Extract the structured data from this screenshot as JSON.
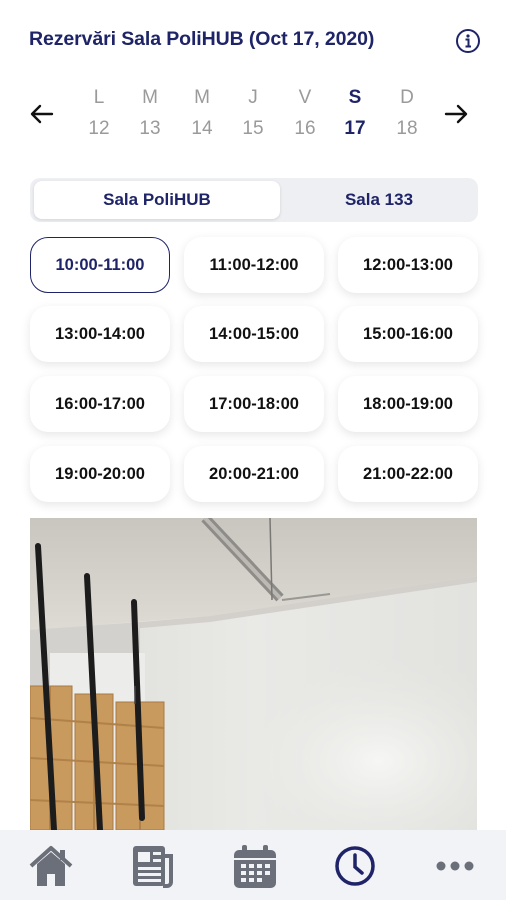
{
  "header": {
    "title": "Rezervări Sala PoliHUB (Oct 17, 2020)",
    "info_icon": "info-icon"
  },
  "week": {
    "prev_icon": "arrow-left-icon",
    "next_icon": "arrow-right-icon",
    "days": [
      {
        "letter": "L",
        "number": "12"
      },
      {
        "letter": "M",
        "number": "13"
      },
      {
        "letter": "M",
        "number": "14"
      },
      {
        "letter": "J",
        "number": "15"
      },
      {
        "letter": "V",
        "number": "16"
      },
      {
        "letter": "S",
        "number": "17",
        "selected": true
      },
      {
        "letter": "D",
        "number": "18"
      }
    ]
  },
  "rooms": {
    "options": [
      "Sala PoliHUB",
      "Sala 133"
    ],
    "selected": "Sala PoliHUB"
  },
  "slots": [
    {
      "label": "10:00-11:00",
      "selected": true
    },
    {
      "label": "11:00-12:00"
    },
    {
      "label": "12:00-13:00"
    },
    {
      "label": "13:00-14:00"
    },
    {
      "label": "14:00-15:00"
    },
    {
      "label": "15:00-16:00"
    },
    {
      "label": "16:00-17:00"
    },
    {
      "label": "17:00-18:00"
    },
    {
      "label": "18:00-19:00"
    },
    {
      "label": "19:00-20:00"
    },
    {
      "label": "20:00-21:00"
    },
    {
      "label": "21:00-22:00"
    }
  ],
  "tabbar": {
    "items": [
      "home-icon",
      "news-icon",
      "calendar-icon",
      "clock-icon",
      "more-icon"
    ],
    "active": "clock-icon"
  },
  "colors": {
    "accent": "#1e2467",
    "inactive_text": "#9a9a9a",
    "tab_icon": "#6b6f79",
    "tabbar_bg": "#f2f3f7"
  }
}
